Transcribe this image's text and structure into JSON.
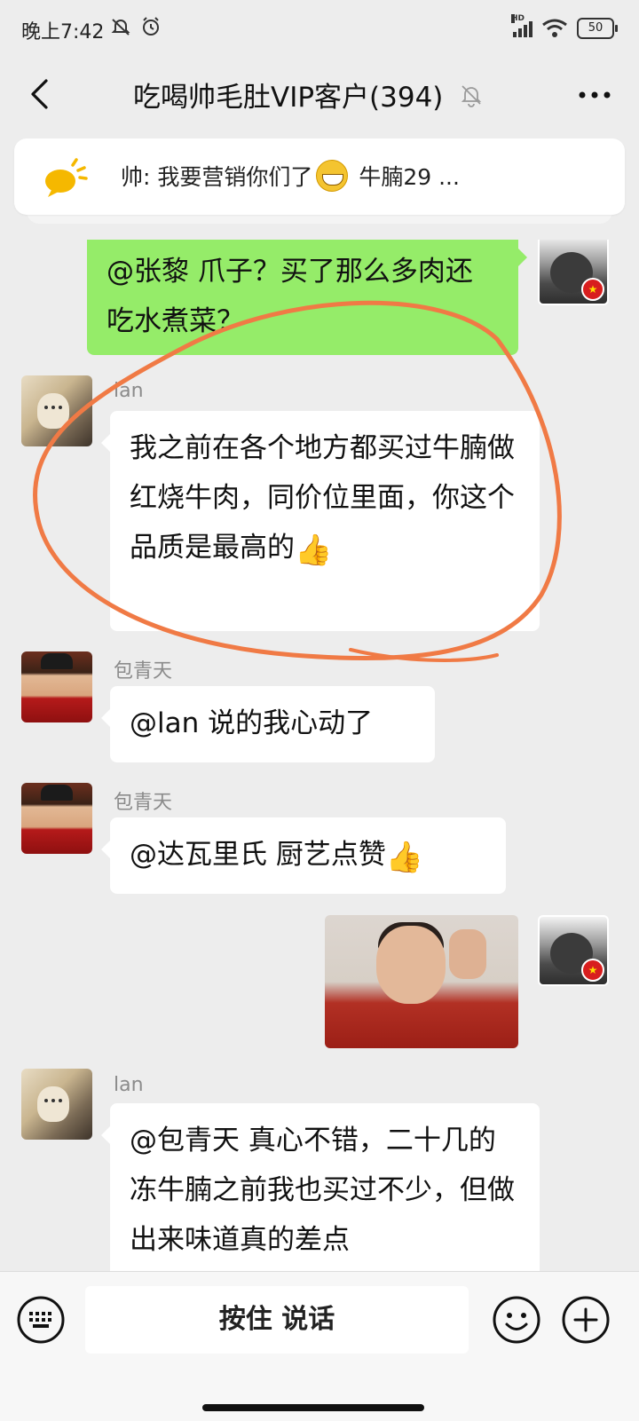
{
  "status_bar": {
    "time": "晚上7:42",
    "left_icons": [
      "mute-bell-icon",
      "alarm-icon"
    ],
    "network_label": "HD",
    "battery": "50"
  },
  "header": {
    "title": "吃喝帅毛肚VIP客户(394)",
    "muted": true
  },
  "notice": {
    "text_before_emoji": "帅: 我要营销你们了",
    "text_after_emoji": " 牛腩29 ..."
  },
  "messages": [
    {
      "direction": "out",
      "sender": "",
      "text": "@张黎  爪子？买了那么多肉还吃水煮菜？"
    },
    {
      "direction": "in",
      "sender": "lan",
      "text": "我之前在各个地方都买过牛腩做红烧牛肉，同价位里面，你这个品质是最高的",
      "emoji": "👍"
    },
    {
      "direction": "in",
      "sender": "包青天",
      "text": "@lan  说的我心动了"
    },
    {
      "direction": "in",
      "sender": "包青天",
      "text": "@达瓦里氏  厨艺点赞",
      "emoji": "👍"
    },
    {
      "direction": "out",
      "sender": "",
      "type": "image"
    },
    {
      "direction": "in",
      "sender": "lan",
      "text": "@包青天  真心不错，二十几的冻牛腩之前我也买过不少，但做出来味道真的差点"
    }
  ],
  "input_bar": {
    "voice_label": "按住 说话"
  },
  "colors": {
    "background": "#ededed",
    "outgoing_bubble": "#95ec69",
    "incoming_bubble": "#ffffff",
    "highlight_stroke": "#f07a45"
  }
}
